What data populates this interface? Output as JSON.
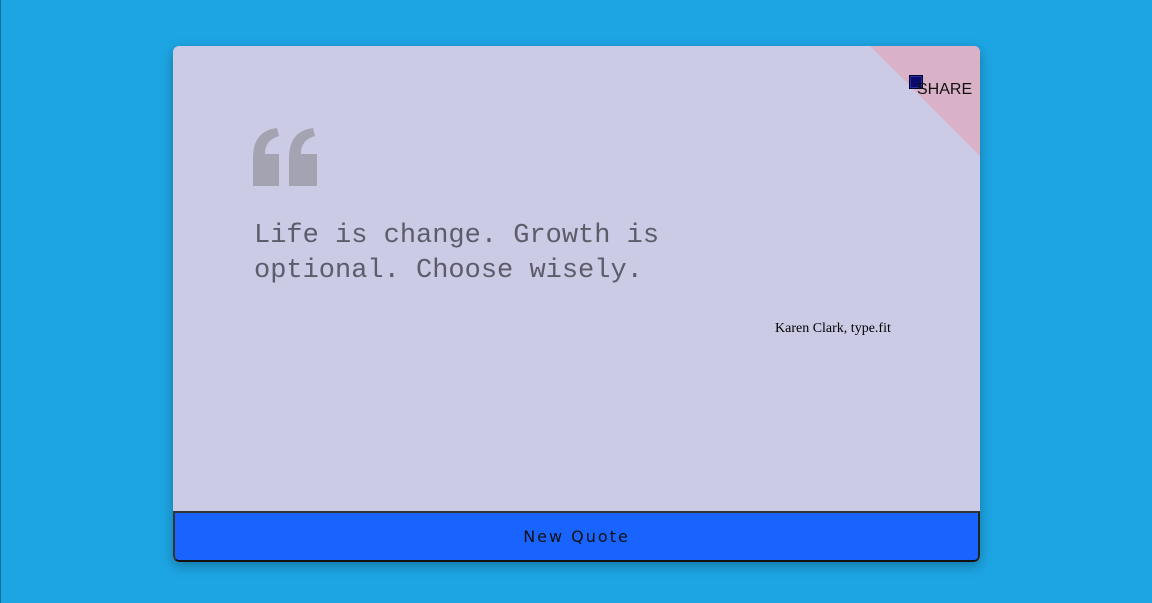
{
  "quote": {
    "text": "Life is change. Growth is optional. Choose wisely.",
    "author": "Karen Clark, type.fit"
  },
  "share": {
    "label": "SHARE"
  },
  "actions": {
    "new_quote_label": "New Quote"
  },
  "colors": {
    "background": "#1da5e3",
    "card": "#cbcbe6",
    "share_corner": "#d9b2c7",
    "button": "#1963ff",
    "quote_icon": "#a3a3b2"
  },
  "icons": {
    "quote": "quote-mark-icon",
    "share": "share-checkbox-icon"
  }
}
